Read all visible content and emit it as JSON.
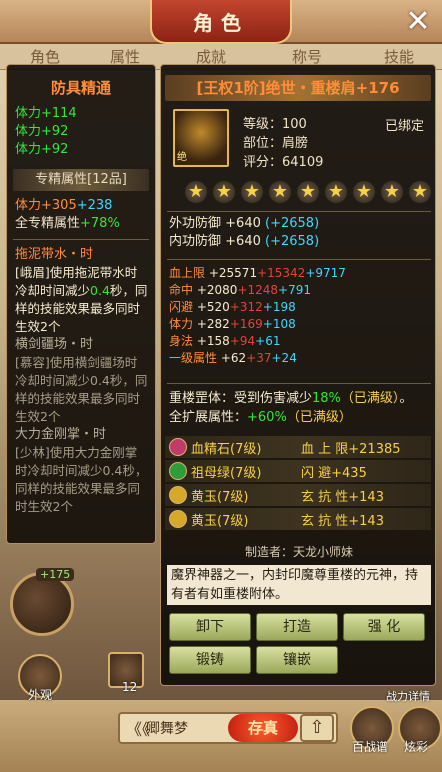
{
  "header": {
    "title": "角色",
    "close_glyph": "✕"
  },
  "bg_tabs": [
    "角色",
    "属性",
    "成就",
    "称号",
    "技能"
  ],
  "left_panel": {
    "title": "防具精通",
    "lines": [
      "体力+114",
      "体力+92",
      "体力+92"
    ],
    "band": "专精属性[12品]",
    "attr1": {
      "label": "体力",
      "v1": "+305",
      "v2": "+238"
    },
    "attr2": {
      "label": "全专精属性",
      "v": "+78%"
    },
    "skills": [
      {
        "title": "拖泥带水・时",
        "desc_pre": "[峨眉]使用拖泥带水时冷却时间减少",
        "desc_hl": "0.4",
        "desc_post": "秒，同样的技能效果最多同时生效2个",
        "active": true
      },
      {
        "title": "横剑疆场・时",
        "desc_pre": "[慕容]使用横剑疆场时冷却时间减少0.4秒，同样的技能效果最多同时生效2个",
        "desc_hl": "",
        "desc_post": "",
        "active": false
      },
      {
        "title": "大力金刚掌・时",
        "desc_pre": "[少林]使用大力金刚掌时冷却时间减少0.4秒，同样的技能效果最多同时生效2个",
        "desc_hl": "",
        "desc_post": "",
        "active": false
      }
    ]
  },
  "item": {
    "name": "[王权1阶]绝世・重楼肩+176",
    "level_label": "等级：",
    "level": "100",
    "slot_label": "部位：",
    "slot": "肩膀",
    "score_label": "评分：",
    "score": "64109",
    "bound": "已绑定",
    "icon_mark": "绝",
    "stars": 9,
    "defense": [
      {
        "label": "外功防御",
        "v": "+640",
        "bonus": "(+2658)"
      },
      {
        "label": "内功防御",
        "v": "+640",
        "bonus": "(+2658)"
      }
    ],
    "stats": [
      {
        "label": "血上限",
        "v1": "+25571",
        "v2": "+15342",
        "v3": "+9717"
      },
      {
        "label": "命中",
        "v1": "+2080",
        "v2": "+1248",
        "v3": "+791"
      },
      {
        "label": "闪避",
        "v1": "+520",
        "v2": "+312",
        "v3": "+198"
      },
      {
        "label": "体力",
        "v1": "+282",
        "v2": "+169",
        "v3": "+108"
      },
      {
        "label": "身法",
        "v1": "+158",
        "v2": "+94",
        "v3": "+61"
      },
      {
        "label": "一级属性",
        "v1": "+62",
        "v2": "+37",
        "v3": "+24"
      }
    ],
    "set1": {
      "pre": "重楼罡体：受到伤害减少",
      "v": "18%",
      "tag": "（已满级）",
      "end": "。"
    },
    "set2": {
      "pre": "全扩展属性：",
      "v": "+60%",
      "tag": "（已满级）"
    },
    "gems": [
      {
        "name": "血精石(7级)",
        "stat": "血 上 限+21385",
        "color": "#c03a6a"
      },
      {
        "name": "祖母绿(7级)",
        "stat": "闪  避+435",
        "color": "#2f9c3a"
      },
      {
        "name": "黄玉(7级)",
        "stat": "玄 抗 性+143",
        "color": "#d6a82a"
      },
      {
        "name": "黄玉(7级)",
        "stat": "玄 抗 性+143",
        "color": "#d6a82a"
      }
    ],
    "maker": "制造者：天龙小师妹",
    "description": "魔界神器之一，内封印魔尊重楼的元神，持有者有如重楼附体。",
    "buttons": [
      "卸下",
      "打造",
      "强 化",
      "锻铸",
      "镶嵌"
    ]
  },
  "bottom": {
    "char_name": "卿舞梦",
    "save_label": "存真",
    "appearance_label": "外观",
    "hammer_count": "12",
    "combat_detail": "战力详情",
    "baizhan_label": "百战谱",
    "xuancai_label": "炫彩",
    "level_badge": "+175"
  }
}
